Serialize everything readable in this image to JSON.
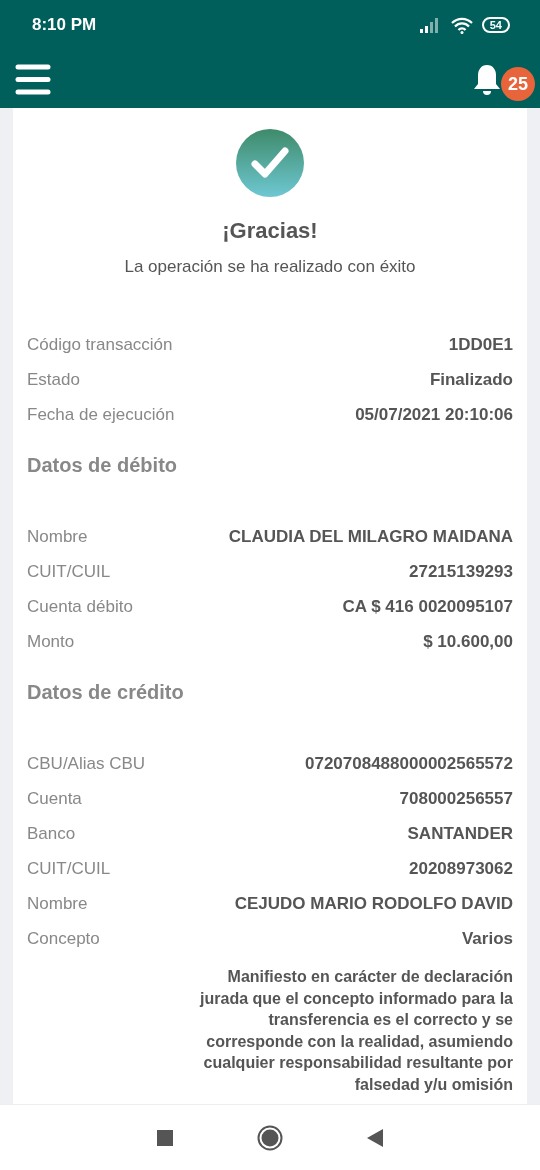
{
  "status_bar": {
    "time": "8:10 PM",
    "battery": "54"
  },
  "app_bar": {
    "notifications_badge": "25"
  },
  "result": {
    "title": "¡Gracias!",
    "message": "La operación se ha realizado con éxito"
  },
  "summary": [
    {
      "label": "Código transacción",
      "value": "1DD0E1"
    },
    {
      "label": "Estado",
      "value": "Finalizado"
    },
    {
      "label": "Fecha de ejecución",
      "value": "05/07/2021 20:10:06"
    }
  ],
  "sections": [
    {
      "title": "Datos de débito",
      "rows": [
        {
          "label": "Nombre",
          "value": "CLAUDIA DEL MILAGRO MAIDANA"
        },
        {
          "label": "CUIT/CUIL",
          "value": "27215139293"
        },
        {
          "label": "Cuenta débito",
          "value": "CA $ 416 0020095107"
        },
        {
          "label": "Monto",
          "value": "$ 10.600,00"
        }
      ]
    },
    {
      "title": "Datos de crédito",
      "rows": [
        {
          "label": "CBU/Alias CBU",
          "value": "0720708488000002565572"
        },
        {
          "label": "Cuenta",
          "value": "708000256557"
        },
        {
          "label": "Banco",
          "value": "SANTANDER"
        },
        {
          "label": "CUIT/CUIL",
          "value": "20208973062"
        },
        {
          "label": "Nombre",
          "value": "CEJUDO MARIO RODOLFO DAVID"
        },
        {
          "label": "Concepto",
          "value": "Varios"
        }
      ]
    }
  ],
  "declaration": "Manifiesto en carácter de declaración jurada que el concepto informado para la transferencia es el correcto y se corresponde con la realidad, asumiendo cualquier responsabilidad resultante por falsedad y/u omisión"
}
